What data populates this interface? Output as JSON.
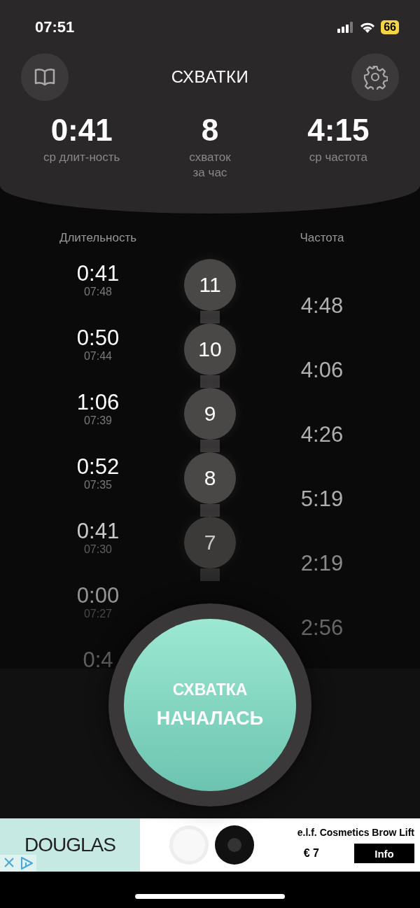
{
  "status_bar": {
    "time": "07:51",
    "battery": "66"
  },
  "header": {
    "title": "СХВАТКИ"
  },
  "stats": [
    {
      "value": "0:41",
      "label": "ср длит-ность"
    },
    {
      "value": "8",
      "label": "схваток за час"
    },
    {
      "value": "4:15",
      "label": "ср частота"
    }
  ],
  "columns": {
    "duration": "Длительность",
    "frequency": "Частота"
  },
  "rows": [
    {
      "duration": "0:41",
      "time": "07:48",
      "number": "11",
      "frequency": "4:48"
    },
    {
      "duration": "0:50",
      "time": "07:44",
      "number": "10",
      "frequency": "4:06"
    },
    {
      "duration": "1:06",
      "time": "07:39",
      "number": "9",
      "frequency": "4:26"
    },
    {
      "duration": "0:52",
      "time": "07:35",
      "number": "8",
      "frequency": "5:19"
    },
    {
      "duration": "0:41",
      "time": "07:30",
      "number": "7",
      "frequency": "2:19"
    },
    {
      "duration": "0:00",
      "time": "07:27",
      "frequency": "2:56"
    },
    {
      "duration": "0:4"
    }
  ],
  "main_button": {
    "line1": "СХВАТКА",
    "line2": "НАЧАЛАСЬ"
  },
  "ad": {
    "brand": "DOUGLAS",
    "title": "e.l.f. Cosmetics Brow Lift",
    "price": "€ 7",
    "button": "Info"
  }
}
